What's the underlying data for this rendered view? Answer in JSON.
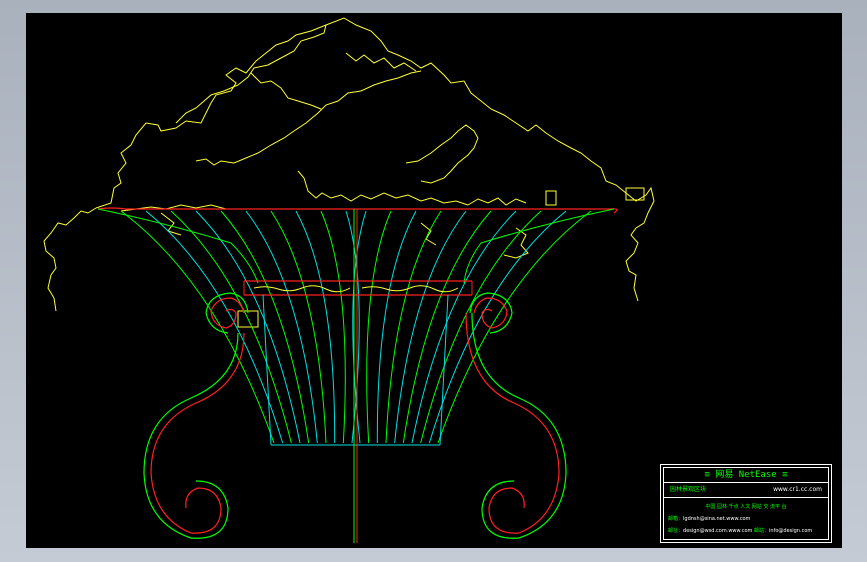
{
  "colors": {
    "background": "#000000",
    "frame": "#a9b1bd",
    "foliage": "#ffff33",
    "basin_ribs": "#00ff00",
    "basin_ribs_alt": "#00e0e0",
    "rim_red": "#ff2020",
    "title_text": "#00ff00"
  },
  "title_block": {
    "title": "≡ 网易 NetEase ≡",
    "subtitle_left": "园林景观区块",
    "subtitle_right": "www.cr1.cc.com",
    "line1": "中国 园林 千点 人文 网站 交 流平 台",
    "line2_label": "邮箱：",
    "line2_value": "lgdnsh@sina.net.www.com",
    "line3_label": "邮址：",
    "line3_value": "design@wsd.com.www.com",
    "line3_label2": "邮站：",
    "line3_value2": "info@design.com"
  }
}
